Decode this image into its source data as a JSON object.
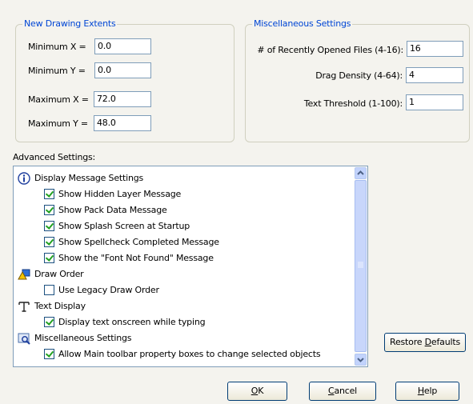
{
  "extents": {
    "title": "New Drawing Extents",
    "min_x_label": "Minimum X =",
    "min_x_value": "0.0",
    "min_y_label": "Minimum Y =",
    "min_y_value": "0.0",
    "max_x_label": "Maximum X =",
    "max_x_value": "72.0",
    "max_y_label": "Maximum Y =",
    "max_y_value": "48.0"
  },
  "misc": {
    "title": "Miscellaneous Settings",
    "recent_label": "# of Recently Opened Files (4-16):",
    "recent_value": "16",
    "drag_label": "Drag Density (4-64):",
    "drag_value": "4",
    "text_label": "Text Threshold (1-100):",
    "text_value": "1"
  },
  "advanced": {
    "label": "Advanced Settings:",
    "categories": [
      {
        "label": "Display Message Settings",
        "icon": "info-icon"
      },
      {
        "label": "Draw Order",
        "icon": "draw-order-icon"
      },
      {
        "label": "Text Display",
        "icon": "text-tool-icon"
      },
      {
        "label": "Miscellaneous Settings",
        "icon": "misc-settings-icon"
      }
    ],
    "items": [
      {
        "label": "Show Hidden Layer Message",
        "checked": true
      },
      {
        "label": "Show Pack Data Message",
        "checked": true
      },
      {
        "label": "Show Splash Screen at Startup",
        "checked": true
      },
      {
        "label": "Show Spellcheck Completed Message",
        "checked": true
      },
      {
        "label": "Show the \"Font Not Found\" Message",
        "checked": true
      },
      {
        "label": "Use Legacy Draw Order",
        "checked": false
      },
      {
        "label": "Display text onscreen while typing",
        "checked": true
      },
      {
        "label": "Allow Main toolbar property boxes to change selected objects",
        "checked": true
      }
    ]
  },
  "buttons": {
    "restore": {
      "before": "Restore ",
      "key": "D",
      "after": "efaults"
    },
    "ok": {
      "before": "",
      "key": "O",
      "after": "K"
    },
    "cancel": {
      "before": "",
      "key": "C",
      "after": "ancel"
    },
    "help": {
      "before": "",
      "key": "H",
      "after": "elp"
    }
  }
}
